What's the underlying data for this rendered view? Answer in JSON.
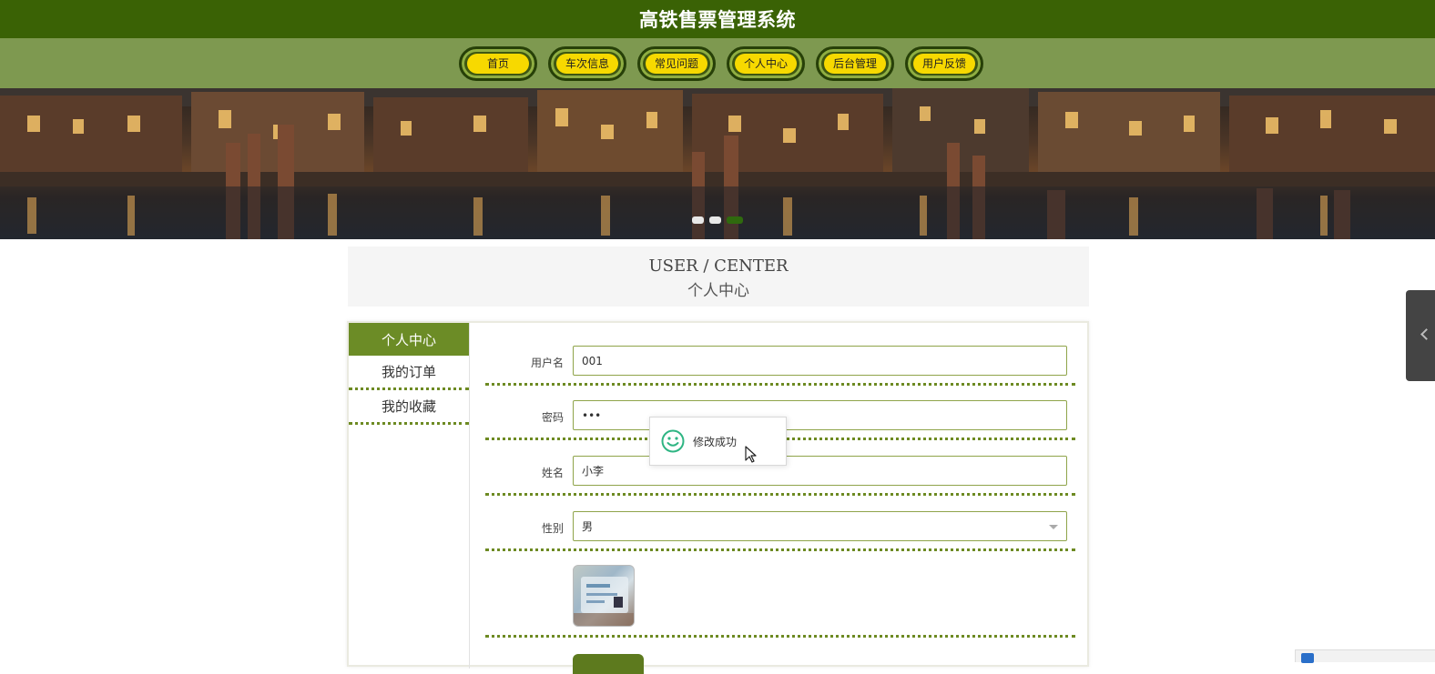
{
  "header": {
    "title": "高铁售票管理系统"
  },
  "nav": {
    "items": [
      {
        "label": "首页"
      },
      {
        "label": "车次信息"
      },
      {
        "label": "常见问题"
      },
      {
        "label": "个人中心"
      },
      {
        "label": "后台管理"
      },
      {
        "label": "用户反馈"
      }
    ]
  },
  "carousel": {
    "slide_count": 3,
    "active_slide": 3
  },
  "section": {
    "title_en": "USER / CENTER",
    "title_cn": "个人中心"
  },
  "sidebar": {
    "items": [
      {
        "label": "个人中心",
        "active": true
      },
      {
        "label": "我的订单",
        "active": false
      },
      {
        "label": "我的收藏",
        "active": false
      }
    ]
  },
  "form": {
    "username": {
      "label": "用户名",
      "value": "001"
    },
    "password": {
      "label": "密码",
      "value": "•••"
    },
    "name": {
      "label": "姓名",
      "value": "小李"
    },
    "gender": {
      "label": "性别",
      "value": "男"
    }
  },
  "toast": {
    "message": "修改成功",
    "icon": "smile-icon"
  },
  "colors": {
    "header_bg": "#3a6205",
    "nav_bg": "#7e9950",
    "nav_pill": "#f7d900",
    "accent": "#6c8c26",
    "toast_icon": "#2fb583"
  }
}
